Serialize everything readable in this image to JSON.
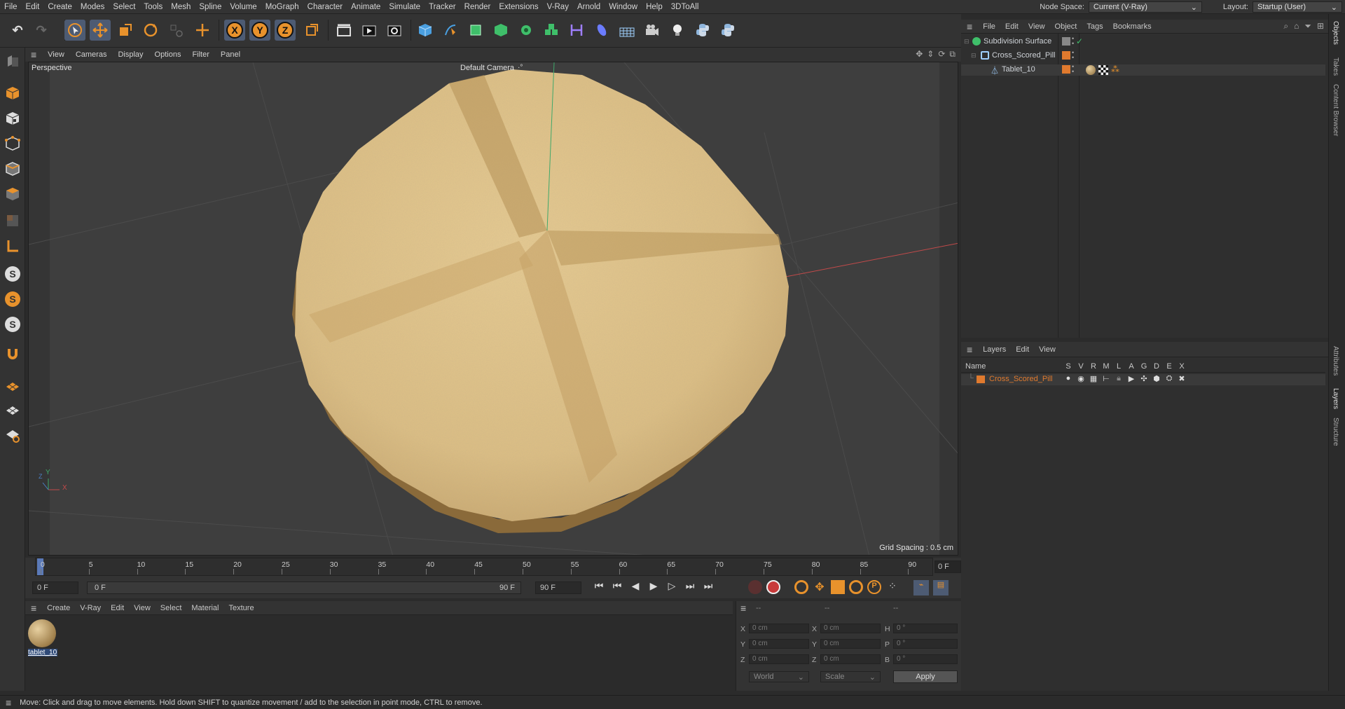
{
  "menu": [
    "File",
    "Edit",
    "Create",
    "Modes",
    "Select",
    "Tools",
    "Mesh",
    "Spline",
    "Volume",
    "MoGraph",
    "Character",
    "Animate",
    "Simulate",
    "Tracker",
    "Render",
    "Extensions",
    "V-Ray",
    "Arnold",
    "Window",
    "Help",
    "3DToAll"
  ],
  "node_space": {
    "label": "Node Space:",
    "value": "Current (V-Ray)"
  },
  "layout": {
    "label": "Layout:",
    "value": "Startup (User)"
  },
  "axis_buttons": {
    "x": "X",
    "y": "Y",
    "z": "Z"
  },
  "snap_letter": "S",
  "viewport": {
    "menu": [
      "View",
      "Cameras",
      "Display",
      "Options",
      "Filter",
      "Panel"
    ],
    "label": "Perspective",
    "camera": "Default Camera",
    "camera_icon": "·°",
    "grid_spacing": "Grid Spacing : 0.5 cm",
    "axis_x": "X",
    "axis_y": "Y",
    "axis_z": "Z"
  },
  "timeline": {
    "ticks": [
      "0",
      "5",
      "10",
      "15",
      "20",
      "25",
      "30",
      "35",
      "40",
      "45",
      "50",
      "55",
      "60",
      "65",
      "70",
      "75",
      "80",
      "85",
      "90"
    ],
    "current_frame": "0 F",
    "start": "0 F",
    "range_start": "0 F",
    "range_end": "90 F",
    "end": "90 F"
  },
  "material": {
    "menu": [
      "Create",
      "V-Ray",
      "Edit",
      "View",
      "Select",
      "Material",
      "Texture"
    ],
    "items": [
      {
        "name": "tablet_10"
      }
    ]
  },
  "coordinates": {
    "headers": [
      "--",
      "--",
      "--"
    ],
    "rows": [
      {
        "a": "X",
        "av": "0 cm",
        "b": "X",
        "bv": "0 cm",
        "c": "H",
        "cv": "0 °"
      },
      {
        "a": "Y",
        "av": "0 cm",
        "b": "Y",
        "bv": "0 cm",
        "c": "P",
        "cv": "0 °"
      },
      {
        "a": "Z",
        "av": "0 cm",
        "b": "Z",
        "bv": "0 cm",
        "c": "B",
        "cv": "0 °"
      }
    ],
    "space": "World",
    "mode": "Scale",
    "apply": "Apply"
  },
  "objects": {
    "menu": [
      "File",
      "Edit",
      "View",
      "Object",
      "Tags",
      "Bookmarks"
    ],
    "items": [
      {
        "name": "Subdivision Surface",
        "color": "#cfd3d8"
      },
      {
        "name": "Cross_Scored_Pill",
        "color": "#cfd3d8"
      },
      {
        "name": "Tablet_10",
        "color": "#cfd3d8"
      }
    ]
  },
  "layers": {
    "menu": [
      "Layers",
      "Edit",
      "View"
    ],
    "name_header": "Name",
    "flags": [
      "S",
      "V",
      "R",
      "M",
      "L",
      "A",
      "G",
      "D",
      "E",
      "X"
    ],
    "items": [
      {
        "name": "Cross_Scored_Pill",
        "color": "#e07a2e"
      }
    ]
  },
  "side_tabs": [
    "Objects",
    "Takes",
    "Content Browser",
    "Attributes",
    "Layers",
    "Structure"
  ],
  "status": "Move: Click and drag to move elements. Hold down SHIFT to quantize movement / add to the selection in point mode, CTRL to remove.",
  "colors": {
    "accent": "#e8922c",
    "selected": "#4d5b73",
    "layer": "#e07a2e"
  }
}
